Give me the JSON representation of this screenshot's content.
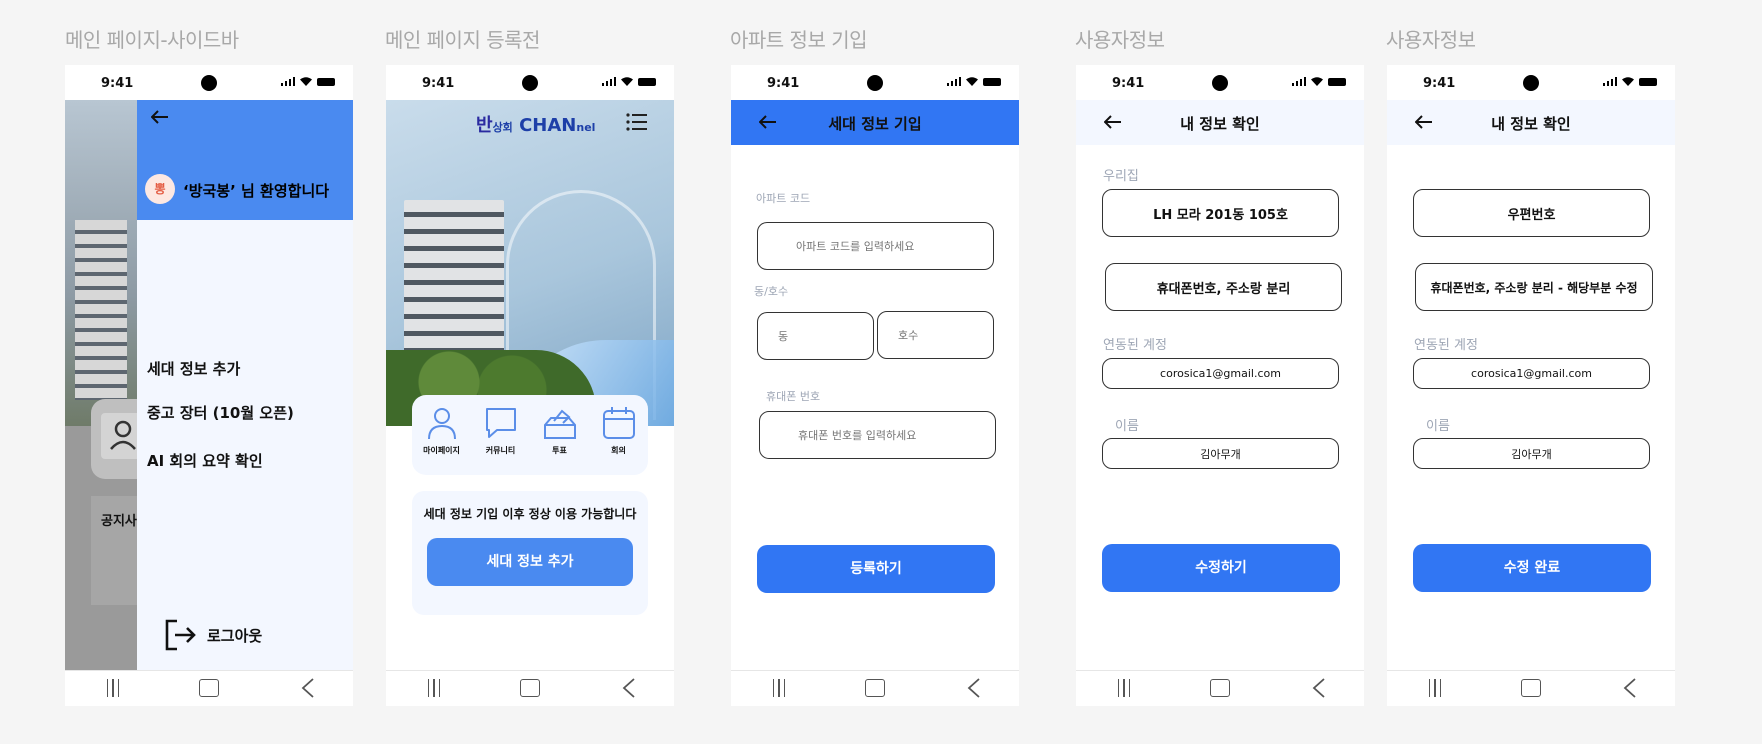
{
  "frame_titles": [
    "메인 페이지-사이드바",
    "메인 페이지 등록전",
    "아파트 정보 기입",
    "사용자정보",
    "사용자정보"
  ],
  "status_time": "9:41",
  "phone1": {
    "avatar_text": "뽕",
    "welcome": "‘방국봉’ 님 환영합니다",
    "menu": [
      "세대 정보 추가",
      "중고 장터 (10월 오픈)",
      "AI 회의 요약 확인"
    ],
    "logout": "로그아웃",
    "bg_notice": "공지사"
  },
  "phone2": {
    "brand_han": "반",
    "brand_sub": "상회",
    "brand_main": "CHAN",
    "brand_tail": "nel",
    "quick": [
      "마이페이지",
      "커뮤니티",
      "투표",
      "회의"
    ],
    "message": "세대 정보 기입 이후 정상 이용 가능합니다",
    "button": "세대 정보 추가"
  },
  "phone3": {
    "title": "세대 정보 기입",
    "apt_label": "아파트 코드",
    "apt_placeholder": "아파트 코드를 입력하세요",
    "dong_label": "동/호수",
    "dong_placeholder": "동",
    "ho_placeholder": "호수",
    "phone_label": "휴대폰 번호",
    "phone_placeholder": "휴대폰 번호를 입력하세요",
    "button": "등록하기"
  },
  "phone4": {
    "title": "내 정보 확인",
    "home_label": "우리집",
    "address": "LH 모라 201동 105호",
    "note": "휴대폰번호, 주소랑 분리",
    "account_label": "연동된 계정",
    "email": "corosica1@gmail.com",
    "name_label": "이름",
    "name": "김아무개",
    "button": "수정하기"
  },
  "phone5": {
    "title": "내 정보 확인",
    "postcode": "우편번호",
    "note": "휴대폰번호, 주소랑 분리 - 해당부분 수정",
    "account_label": "연동된 계정",
    "email": "corosica1@gmail.com",
    "name_label": "이름",
    "name": "김아무개",
    "button": "수정 완료"
  },
  "colors": {
    "primary": "#3176f3",
    "drawer_header": "#4a8af0",
    "light_bg": "#f3f7ff"
  }
}
